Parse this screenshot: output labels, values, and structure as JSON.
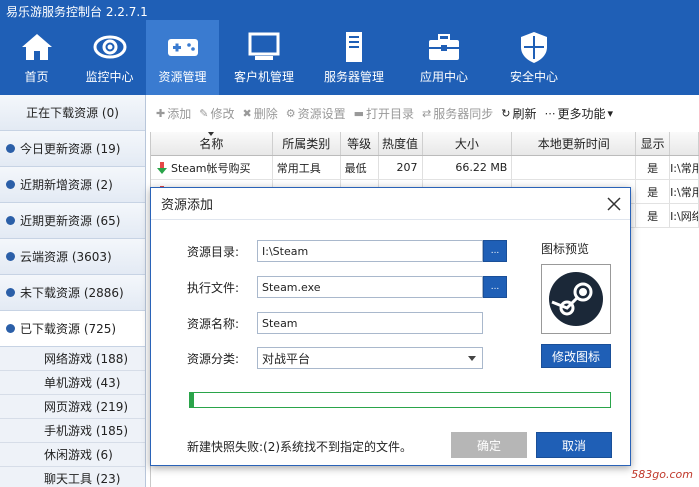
{
  "app_title": "易乐游服务控制台 2.2.7.1",
  "nav": [
    {
      "label": "首页",
      "icon": "home-icon"
    },
    {
      "label": "监控中心",
      "icon": "eye-icon"
    },
    {
      "label": "资源管理",
      "icon": "gamepad-icon",
      "active": true
    },
    {
      "label": "客户机管理",
      "icon": "monitor-icon"
    },
    {
      "label": "服务器管理",
      "icon": "server-icon"
    },
    {
      "label": "应用中心",
      "icon": "toolbox-icon"
    },
    {
      "label": "安全中心",
      "icon": "shield-icon"
    }
  ],
  "sidebar": {
    "items": [
      {
        "label": "正在下载资源 (0)"
      },
      {
        "label": "今日更新资源 (19)"
      },
      {
        "label": "近期新增资源 (2)"
      },
      {
        "label": "近期更新资源 (65)"
      },
      {
        "label": "云端资源 (3603)"
      },
      {
        "label": "未下载资源 (2886)"
      },
      {
        "label": "已下载资源 (725)"
      }
    ],
    "sub_items": [
      {
        "label": "网络游戏 (188)"
      },
      {
        "label": "单机游戏 (43)"
      },
      {
        "label": "网页游戏 (219)"
      },
      {
        "label": "手机游戏 (185)"
      },
      {
        "label": "休闲游戏 (6)"
      },
      {
        "label": "聊天工具 (23)"
      }
    ]
  },
  "toolbar": {
    "add": "添加",
    "edit": "修改",
    "delete": "删除",
    "settings": "资源设置",
    "open_dir": "打开目录",
    "sync": "服务器同步",
    "refresh": "刷新",
    "more": "更多功能"
  },
  "table": {
    "headers": [
      "名称",
      "所属类别",
      "等级",
      "热度值",
      "大小",
      "本地更新时间",
      "显示",
      ""
    ],
    "rows": [
      {
        "name": "Steam帐号购买",
        "category": "常用工具",
        "level": "最低",
        "heat": "207",
        "size": "66.22 MB",
        "update": "",
        "show": "是",
        "path": "I:\\常用"
      },
      {
        "name": "",
        "category": "",
        "level": "",
        "heat": "",
        "size": "",
        "update": "",
        "show": "是",
        "path": "I:\\常用"
      },
      {
        "name": "",
        "category": "",
        "level": "",
        "heat": "",
        "size": "",
        "update": "",
        "show": "是",
        "path": "I:\\网络"
      }
    ]
  },
  "modal": {
    "title": "资源添加",
    "dir_label": "资源目录:",
    "dir_value": "I:\\Steam",
    "exe_label": "执行文件:",
    "exe_value": "Steam.exe",
    "name_label": "资源名称:",
    "name_value": "Steam",
    "category_label": "资源分类:",
    "category_value": "对战平台",
    "browse": "...",
    "preview_label": "图标预览",
    "change_icon": "修改图标",
    "progress": 0.01,
    "status": "新建快照失败:(2)系统找不到指定的文件。",
    "ok": "确定",
    "cancel": "取消"
  },
  "watermark": "583go.com"
}
